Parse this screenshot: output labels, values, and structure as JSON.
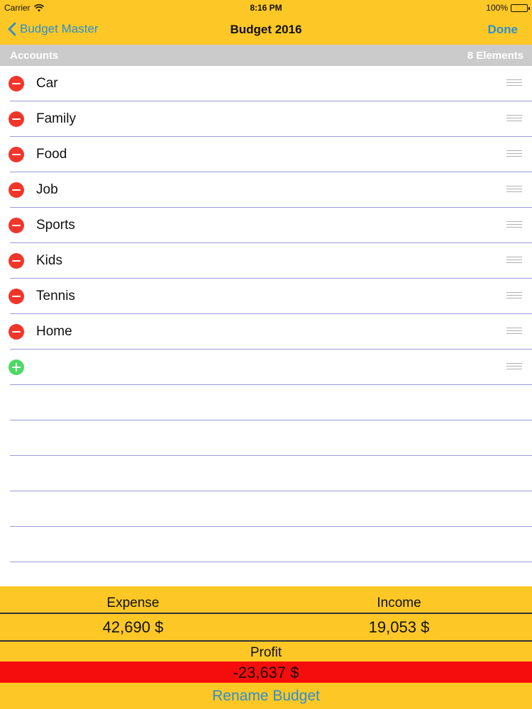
{
  "status_bar": {
    "carrier": "Carrier",
    "time": "8:16 PM",
    "battery": "100%",
    "icons": [
      "wifi-icon",
      "battery-icon"
    ]
  },
  "nav": {
    "back_label": "Budget Master",
    "title": "Budget 2016",
    "done_label": "Done",
    "icons": [
      "chevron-left-icon"
    ]
  },
  "section": {
    "title": "Accounts",
    "count": "8 Elements"
  },
  "accounts": [
    {
      "label": "Car"
    },
    {
      "label": "Family"
    },
    {
      "label": "Food"
    },
    {
      "label": "Job"
    },
    {
      "label": "Sports"
    },
    {
      "label": "Kids"
    },
    {
      "label": "Tennis"
    },
    {
      "label": "Home"
    }
  ],
  "summary": {
    "expense_label": "Expense",
    "income_label": "Income",
    "expense_value": "42,690 $",
    "income_value": "19,053 $",
    "profit_label": "Profit",
    "profit_value": "-23,637 $",
    "rename_label": "Rename Budget"
  },
  "colors": {
    "accent_yellow": "#FDC826",
    "link_blue": "#2C8FD0",
    "delete_red": "#F0362B",
    "add_green": "#4CD964",
    "profit_red": "#F50D0D",
    "section_gray": "#CBCBCB"
  }
}
